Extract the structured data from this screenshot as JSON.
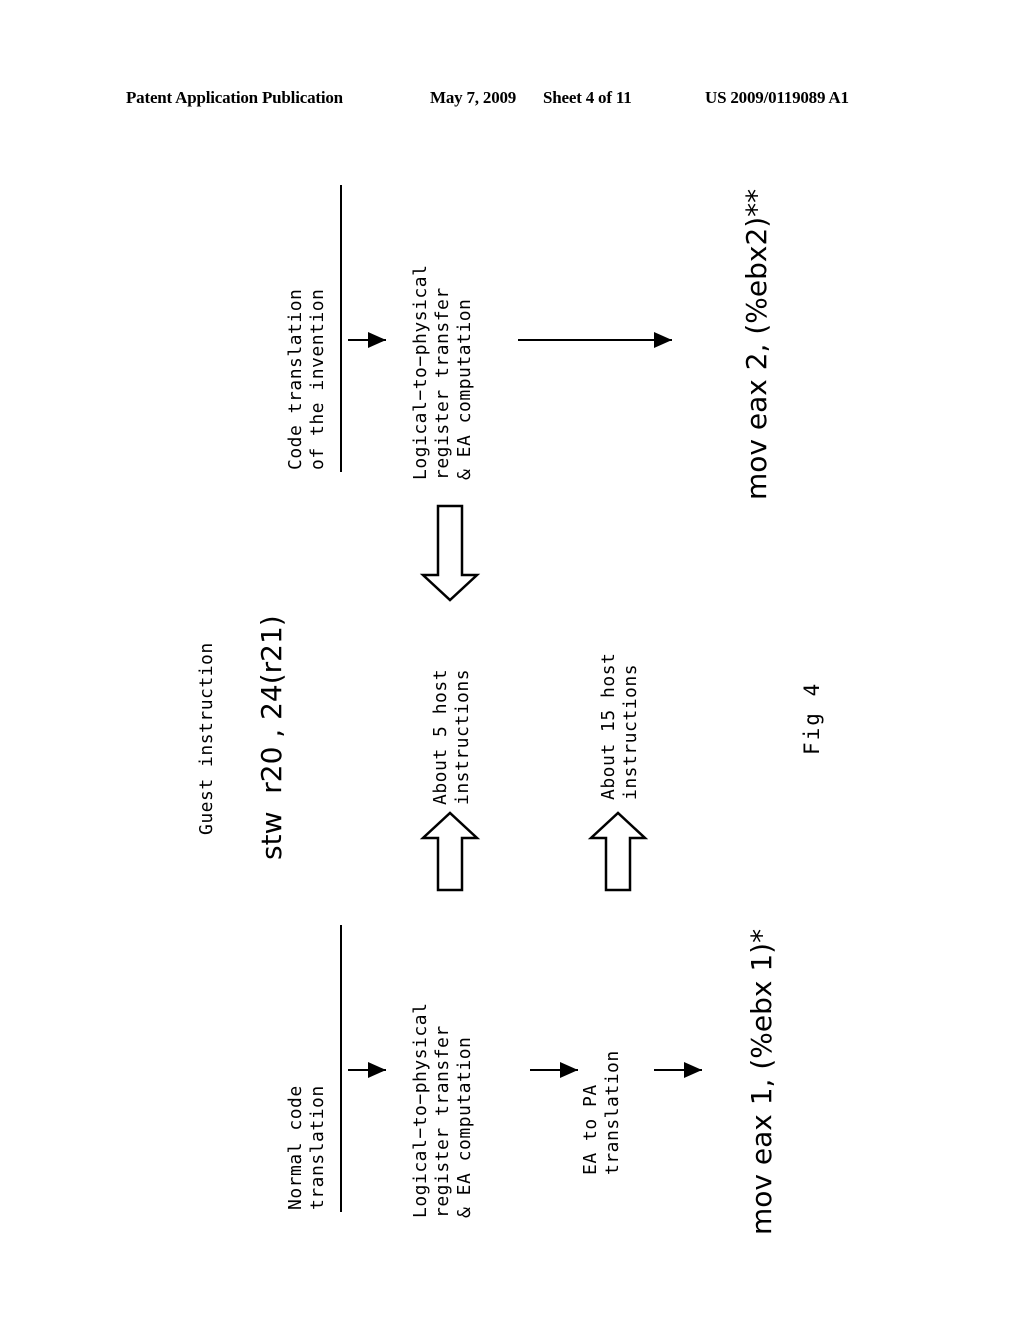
{
  "header": {
    "publication": "Patent Application Publication",
    "date": "May 7, 2009",
    "sheet": "Sheet 4 of 11",
    "patent_number": "US 2009/0119089 A1"
  },
  "figure": {
    "caption": "Fig 4",
    "guest": {
      "label": "Guest instruction",
      "code": "stw  r20 , 24(r21)"
    },
    "invention_path": {
      "heading_line1": "Code translation",
      "heading_line2": "of the invention",
      "stage_line1": "Logical−to−physical",
      "stage_line2": "register transfer",
      "stage_line3": "& EA computation",
      "result": "mov eax 2, (%ebx2)**",
      "cost_line1": "About 5 host",
      "cost_line2": "instructions"
    },
    "normal_path": {
      "heading_line1": "Normal code",
      "heading_line2": "translation",
      "stage1_line1": "Logical−to−physical",
      "stage1_line2": "register transfer",
      "stage1_line3": "& EA computation",
      "stage2_line1": "EA to PA",
      "stage2_line2": "translation",
      "result": "mov eax 1, (%ebx 1)*",
      "cost_line1": "About 15 host",
      "cost_line2": "instructions"
    },
    "icons": {
      "flow_arrow": "arrow-right-icon",
      "block_arrow_down": "block-arrow-down-icon",
      "block_arrow_up": "block-arrow-up-icon"
    },
    "colors": {
      "ink": "#000000",
      "paper": "#ffffff"
    }
  }
}
